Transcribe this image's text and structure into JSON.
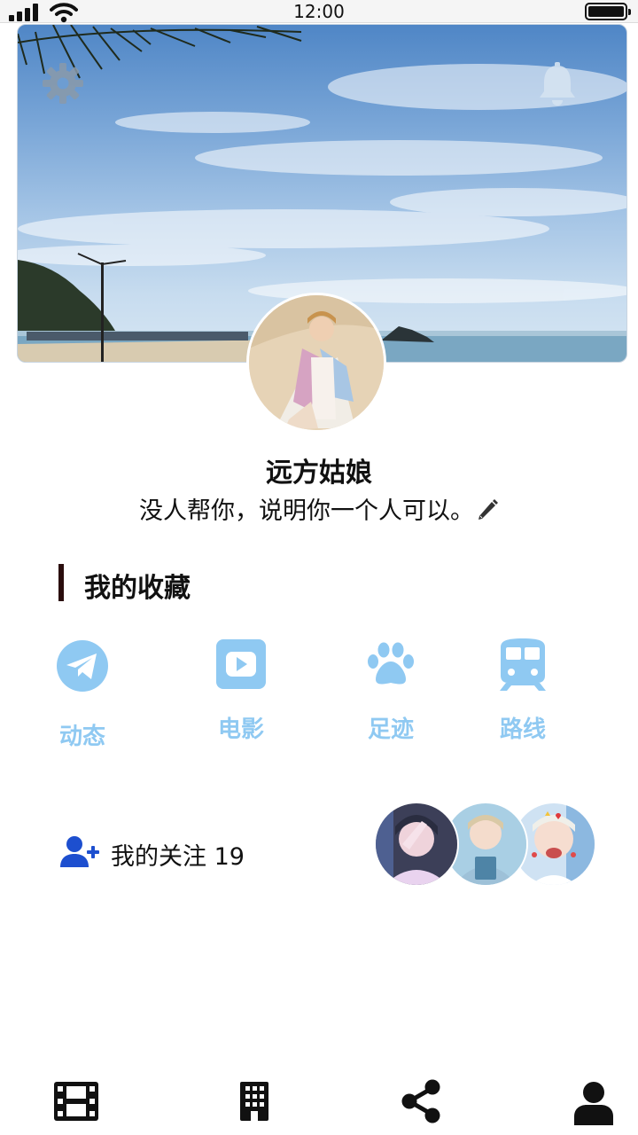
{
  "status_bar": {
    "time": "12:00"
  },
  "cover": {
    "settings_icon": "gear-icon",
    "notification_icon": "bell-icon"
  },
  "profile": {
    "name": "远方姑娘",
    "bio": "没人帮你，说明你一个人可以。",
    "edit_icon": "pencil-icon"
  },
  "favorites": {
    "title": "我的收藏",
    "accent": "#8fc9f2",
    "items": [
      {
        "label": "动态",
        "icon": "telegram-icon"
      },
      {
        "label": "电影",
        "icon": "youtube-icon"
      },
      {
        "label": "足迹",
        "icon": "paw-icon"
      },
      {
        "label": "路线",
        "icon": "subway-icon"
      }
    ]
  },
  "following": {
    "label": "我的关注 19",
    "icon": "user-plus-icon",
    "icon_color": "#1d4fcf"
  },
  "bottom_nav": [
    {
      "icon": "film-icon"
    },
    {
      "icon": "building-icon"
    },
    {
      "icon": "share-icon"
    },
    {
      "icon": "user-icon"
    }
  ]
}
